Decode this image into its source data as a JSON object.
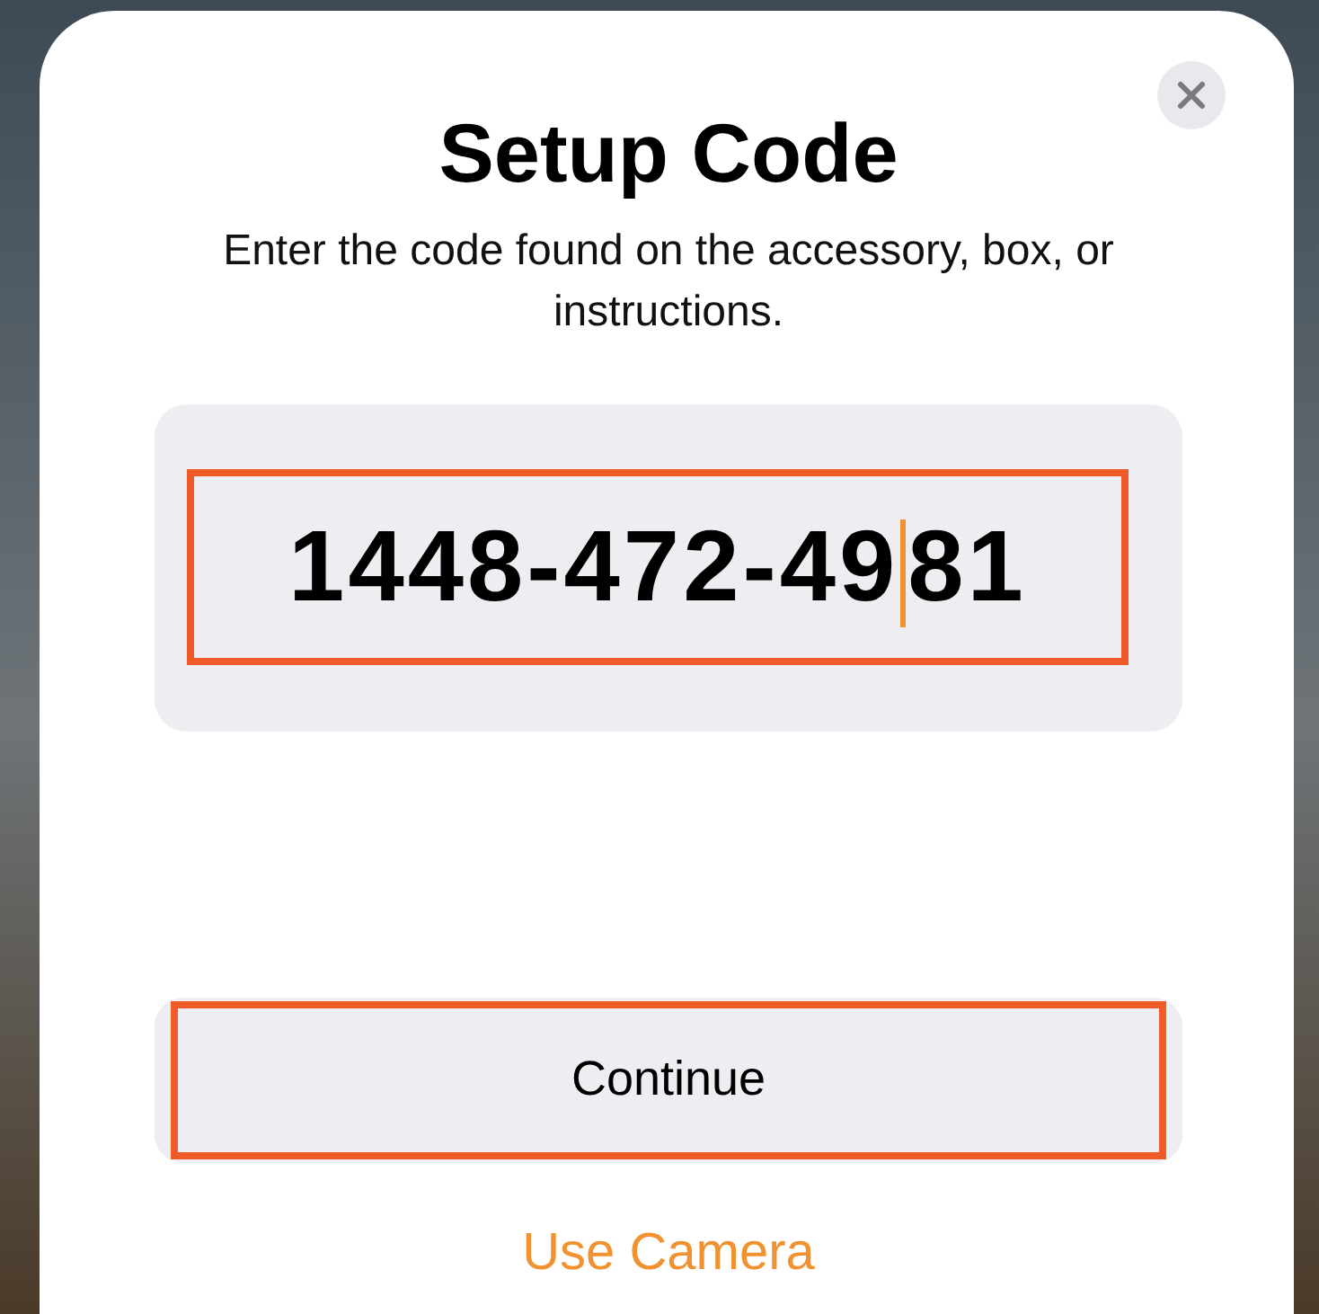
{
  "sheet": {
    "title": "Setup Code",
    "subtitle": "Enter the code found on the accessory, box, or instructions.",
    "code_field": {
      "value": "1448-472-4981",
      "caret": {
        "level": 0.846
      }
    },
    "continue_button": "Continue",
    "camera_link": "Use Camera"
  }
}
